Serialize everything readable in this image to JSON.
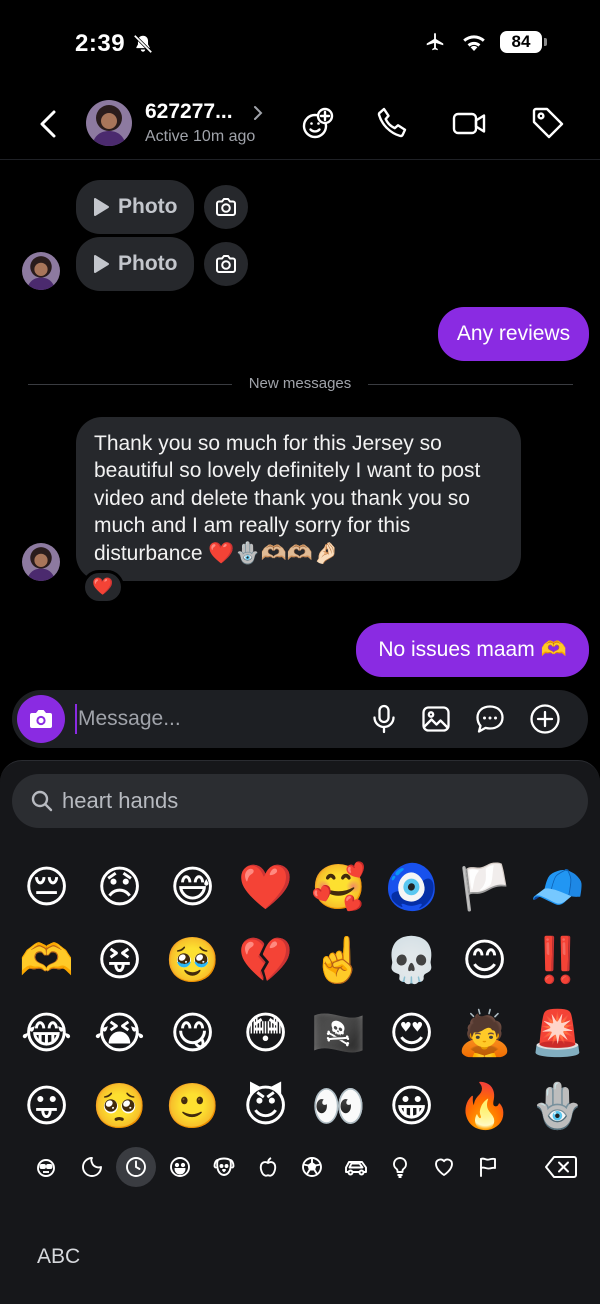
{
  "status_bar": {
    "time": "2:39",
    "battery": "84"
  },
  "header": {
    "contact_name": "627277...",
    "contact_status": "Active 10m ago"
  },
  "conversation": {
    "photo_messages": [
      "Photo",
      "Photo"
    ],
    "sent_message_1": "Any reviews",
    "divider_label": "New messages",
    "received_message": "Thank you so much for this Jersey so beautiful so lovely definitely I want to post video and delete thank you thank you so much and I am really sorry for this disturbance ❤️🪬🫶🏼🫶🏼🤌🏻",
    "reaction": "❤️",
    "sent_message_2": "No issues maam 🫶"
  },
  "composer": {
    "placeholder": "Message..."
  },
  "emoji_keyboard": {
    "search_text": "heart hands",
    "emojis": [
      "😔",
      "😞",
      "😅",
      "❤️",
      "🥰",
      "🧿",
      "🏳️",
      "🧢",
      "🫶",
      "😝",
      "🥹",
      "💔",
      "☝️",
      "💀",
      "😊",
      "‼️",
      "😂",
      "😭",
      "😋",
      "😳",
      "🏴‍☠️",
      "😍",
      "🙇",
      "🚨",
      "😛",
      "🥺",
      "🙂",
      "😈",
      "👀",
      "😀",
      "🔥",
      "🪬"
    ],
    "abc_label": "ABC"
  },
  "colors": {
    "accent": "#8a2be2",
    "bubble_incoming": "#26282c",
    "background": "#000000"
  }
}
